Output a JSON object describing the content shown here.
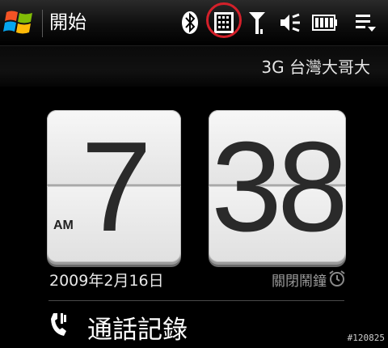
{
  "title_bar": {
    "title": "開始",
    "status_icons": [
      "bluetooth-icon",
      "data-connection-icon",
      "signal-strength-icon",
      "volume-icon",
      "battery-icon",
      "menu-icon"
    ]
  },
  "carrier": "3G 台灣大哥大",
  "clock": {
    "hour": "7",
    "minute": "38",
    "ampm": "AM"
  },
  "date": "2009年2月16日",
  "alarm": {
    "label": "關閉鬧鐘",
    "icon": "alarm-clock-icon"
  },
  "call_history": {
    "label": "通話記錄",
    "icon": "phone-icon"
  },
  "image_id": "#120825",
  "colors": {
    "background": "#000000",
    "highlight_ring": "#d4202a",
    "card": "#eeeeee",
    "digit": "#2a2a2a"
  }
}
